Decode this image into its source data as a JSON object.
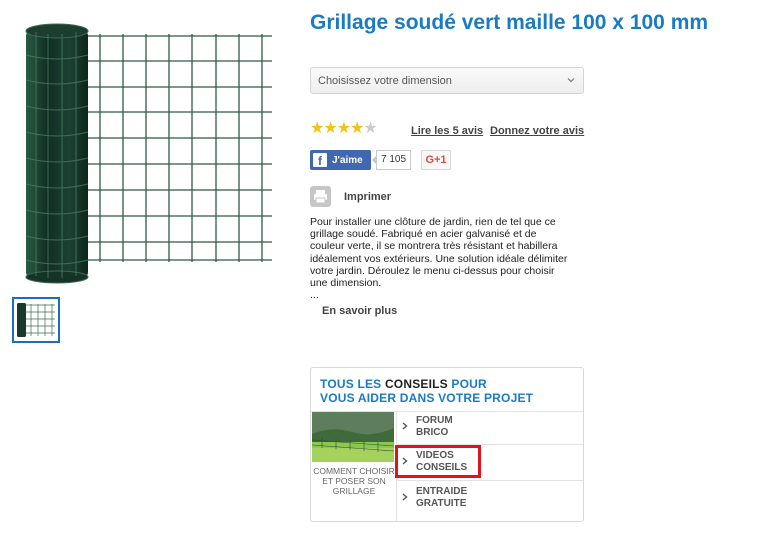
{
  "product": {
    "title": "Grillage soudé vert maille 100 x 100 mm",
    "image_alt": "grillage-roll-image",
    "thumbnail_alt": "grillage-thumbnail"
  },
  "dimension_select": {
    "placeholder": "Choisissez votre dimension"
  },
  "rating": {
    "stars_filled": 4,
    "stars_total": 5,
    "reviews_link": "Lire les 5 avis",
    "give_review_link": "Donnez votre avis"
  },
  "social": {
    "fb_glyph": "f",
    "fb_like": "J'aime",
    "fb_count": "7 105",
    "gplus": "G+1"
  },
  "print": {
    "label": "Imprimer"
  },
  "description": {
    "text": "Pour installer une clôture de jardin, rien de tel que ce grillage soudé. Fabriqué en acier galvanisé et de couleur verte, il se montrera très résistant et habillera idéalement vos extérieurs. Une solution idéale délimiter votre jardin. Déroulez le menu ci-dessus pour choisir une dimension.",
    "ellipsis": "...",
    "more_link": "En savoir plus"
  },
  "conseils": {
    "heading_part1": "TOUS LES ",
    "heading_part2": "CONSEILS",
    "heading_part3": " POUR",
    "heading_line2": "VOUS AIDER DANS VOTRE PROJET",
    "video_caption": "COMMENT CHOISIR ET POSER SON GRILLAGE",
    "items": [
      {
        "label": "FORUM BRICO"
      },
      {
        "label": "VIDEOS CONSEILS"
      },
      {
        "label": "ENTRAIDE GRATUITE"
      }
    ]
  },
  "colors": {
    "brand_blue": "#1a7bc4",
    "facebook_blue": "#4267b2",
    "highlight_red": "#e0141e",
    "star_gold": "#f1c40f"
  }
}
